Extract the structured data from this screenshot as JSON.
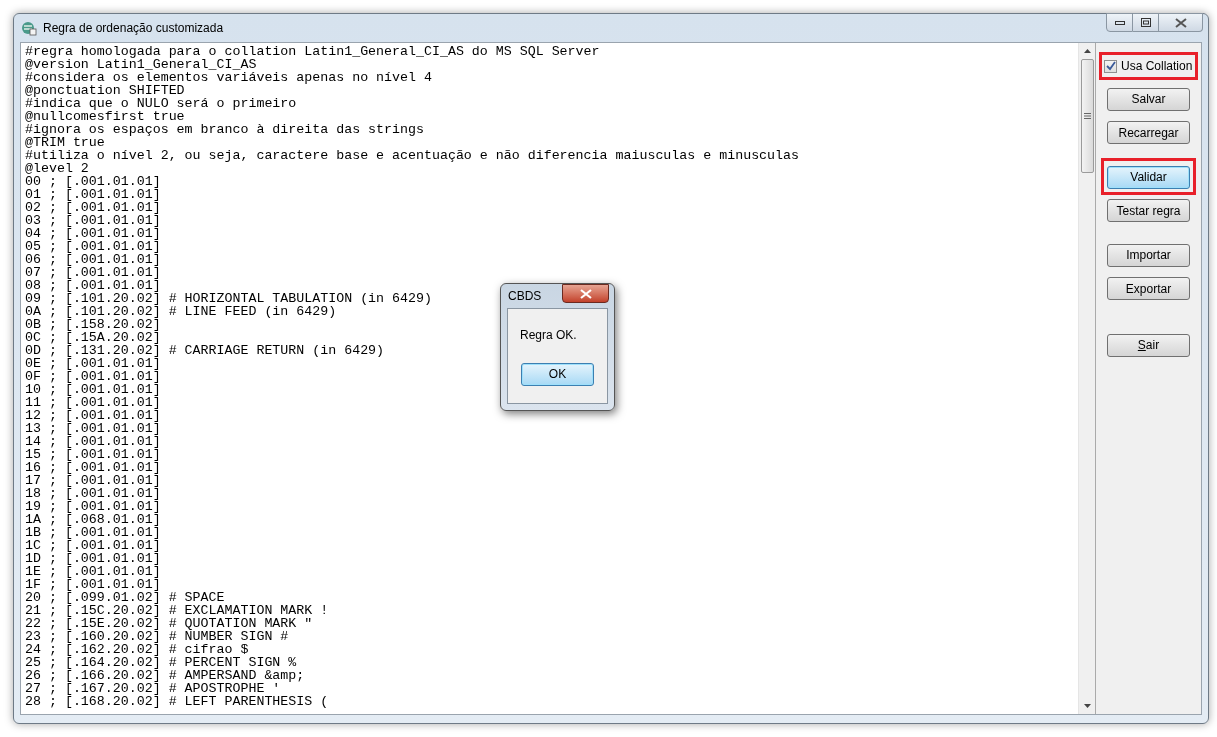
{
  "window": {
    "title": "Regra de ordenação customizada"
  },
  "editor": {
    "lines": [
      "#regra homologada para o collation Latin1_General_CI_AS do MS SQL Server",
      "@version Latin1_General_CI_AS",
      "#considera os elementos variáveis apenas no nível 4",
      "@ponctuation SHIFTED",
      "#indica que o NULO será o primeiro",
      "@nullcomesfirst true",
      "#ignora os espaços em branco à direita das strings",
      "@TRIM true",
      "#utiliza o nível 2, ou seja, caractere base e acentuação e não diferencia maiusculas e minusculas",
      "@level 2",
      "00 ; [.001.01.01]",
      "01 ; [.001.01.01]",
      "02 ; [.001.01.01]",
      "03 ; [.001.01.01]",
      "04 ; [.001.01.01]",
      "05 ; [.001.01.01]",
      "06 ; [.001.01.01]",
      "07 ; [.001.01.01]",
      "08 ; [.001.01.01]",
      "09 ; [.101.20.02] # HORIZONTAL TABULATION (in 6429)",
      "0A ; [.101.20.02] # LINE FEED (in 6429)",
      "0B ; [.158.20.02]",
      "0C ; [.15A.20.02]",
      "0D ; [.131.20.02] # CARRIAGE RETURN (in 6429)",
      "0E ; [.001.01.01]",
      "0F ; [.001.01.01]",
      "10 ; [.001.01.01]",
      "11 ; [.001.01.01]",
      "12 ; [.001.01.01]",
      "13 ; [.001.01.01]",
      "14 ; [.001.01.01]",
      "15 ; [.001.01.01]",
      "16 ; [.001.01.01]",
      "17 ; [.001.01.01]",
      "18 ; [.001.01.01]",
      "19 ; [.001.01.01]",
      "1A ; [.068.01.01]",
      "1B ; [.001.01.01]",
      "1C ; [.001.01.01]",
      "1D ; [.001.01.01]",
      "1E ; [.001.01.01]",
      "1F ; [.001.01.01]",
      "20 ; [.099.01.02] # SPACE",
      "21 ; [.15C.20.02] # EXCLAMATION MARK !",
      "22 ; [.15E.20.02] # QUOTATION MARK \"",
      "23 ; [.160.20.02] # NUMBER SIGN #",
      "24 ; [.162.20.02] # cifrao $",
      "25 ; [.164.20.02] # PERCENT SIGN %",
      "26 ; [.166.20.02] # AMPERSAND &amp;",
      "27 ; [.167.20.02] # APOSTROPHE '",
      "28 ; [.168.20.02] # LEFT PARENTHESIS ("
    ]
  },
  "sidebar": {
    "checkbox": {
      "label": "Usa Collation",
      "checked": true,
      "highlighted": true
    },
    "button_groups": [
      [
        {
          "label": "Salvar",
          "focused": false,
          "highlighted": false
        },
        {
          "label": "Recarregar",
          "focused": false,
          "highlighted": false
        }
      ],
      [
        {
          "label": "Validar",
          "focused": true,
          "highlighted": true
        },
        {
          "label": "Testar regra",
          "focused": false,
          "highlighted": false
        }
      ],
      [
        {
          "label": "Importar",
          "focused": false,
          "highlighted": false
        },
        {
          "label": "Exportar",
          "focused": false,
          "highlighted": false
        }
      ],
      [
        {
          "label": "Sair",
          "focused": false,
          "highlighted": false,
          "access_key": true
        }
      ]
    ]
  },
  "dialog": {
    "title": "CBDS",
    "message": "Regra OK.",
    "button": {
      "label": "OK",
      "focused": true
    }
  }
}
